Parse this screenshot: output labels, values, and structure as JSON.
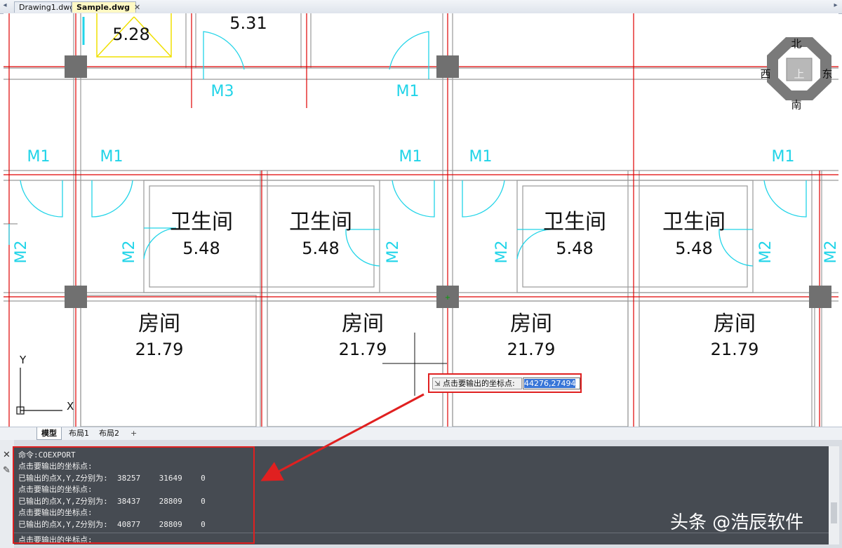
{
  "tabs": {
    "nav_left": "◂",
    "nav_right": "▸",
    "items": [
      {
        "label": "Drawing1.dwg"
      },
      {
        "label": "Sample.dwg"
      }
    ],
    "close": "✕"
  },
  "drawing": {
    "rooms": [
      {
        "name": "卫生间",
        "area": "5.48"
      },
      {
        "name": "卫生间",
        "area": "5.48"
      },
      {
        "name": "卫生间",
        "area": "5.48"
      },
      {
        "name": "卫生间",
        "area": "5.48"
      },
      {
        "name": "房间",
        "area": "21.79"
      },
      {
        "name": "房间",
        "area": "21.79"
      },
      {
        "name": "房间",
        "area": "21.79"
      },
      {
        "name": "房间",
        "area": "21.79"
      }
    ],
    "top_areas": [
      "5.28",
      "5.31"
    ],
    "doors": [
      "M3",
      "M1",
      "M1",
      "M1",
      "M1",
      "M1",
      "M1",
      "M2",
      "M2",
      "M2",
      "M2",
      "M2",
      "M2"
    ],
    "axis": {
      "y": "Y",
      "x": "X"
    },
    "compass": {
      "north": "北",
      "south": "南",
      "east": "东",
      "west": "西",
      "center": "上"
    },
    "colors": {
      "axis_line": "#e00000",
      "door": "#21d4e8",
      "wall": "#9a9a9a",
      "column": "#707070",
      "highlight": "#e02020"
    }
  },
  "prompt": {
    "label": "点击要输出的坐标点:",
    "value": "44276,27494"
  },
  "layout_tabs": [
    "模型",
    "布局1",
    "布局2",
    "+"
  ],
  "command": {
    "lines": [
      "命令:COEXPORT",
      "点击要输出的坐标点:",
      "已输出的点X,Y,Z分别为:  38257    31649    0",
      "点击要输出的坐标点:",
      "已输出的点X,Y,Z分别为:  38437    28809    0",
      "点击要输出的坐标点:",
      "已输出的点X,Y,Z分别为:  40877    28809    0",
      "点击要输出的坐标点:"
    ],
    "current": "点击要输出的坐标点:",
    "close_icon": "close-icon",
    "options_icon": "pencil-icon"
  },
  "watermark": "头条 @浩辰软件"
}
